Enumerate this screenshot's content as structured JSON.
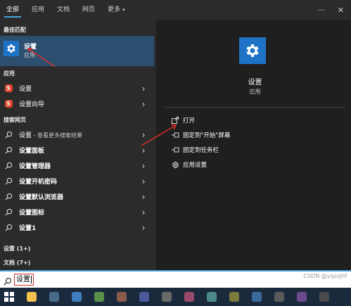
{
  "top_tabs": [
    {
      "label": "全部",
      "active": true
    },
    {
      "label": "应用",
      "active": false
    },
    {
      "label": "文档",
      "active": false
    },
    {
      "label": "网页",
      "active": false
    },
    {
      "label": "更多",
      "active": false,
      "caret": "▾"
    }
  ],
  "top_icons": {
    "more": "···",
    "close": "✕"
  },
  "best_match": {
    "section": "最佳匹配",
    "title": "设置",
    "subtitle": "应用",
    "icon": "gear-icon",
    "tile_color": "#1e73c7",
    "highlight_color": "#2d4f6f"
  },
  "apps": {
    "section": "应用",
    "items": [
      {
        "label": "设置",
        "icon": "red-app-icon"
      },
      {
        "label": "设置向导",
        "icon": "red-app-icon"
      }
    ]
  },
  "web": {
    "section": "搜索网页",
    "items": [
      {
        "label": "设置",
        "sub": " - 查看更多搜索结果",
        "bold": false
      },
      {
        "label": "设置面板",
        "bold": true
      },
      {
        "label": "设置管理器",
        "bold": true
      },
      {
        "label": "设置开机密码",
        "bold": true
      },
      {
        "label": "设置默认浏览器",
        "bold": true
      },
      {
        "label": "设置图标",
        "bold": true
      },
      {
        "label": "设置1",
        "bold": true
      }
    ]
  },
  "more_sections": [
    {
      "label": "设置 (1+)"
    },
    {
      "label": "文档 (7+)"
    }
  ],
  "preview": {
    "title": "设置",
    "subtitle": "应用",
    "actions": [
      {
        "label": "打开",
        "icon": "open-icon"
      },
      {
        "label": "固定到\"开始\"屏幕",
        "icon": "pin-icon"
      },
      {
        "label": "固定到任务栏",
        "icon": "pin-icon"
      },
      {
        "label": "应用设置",
        "icon": "gear-icon"
      }
    ]
  },
  "search": {
    "value": "设置"
  },
  "watermark": "CSDN @yqssjhf",
  "colors": {
    "accent": "#4aa3df",
    "annotation": "#d93025"
  }
}
